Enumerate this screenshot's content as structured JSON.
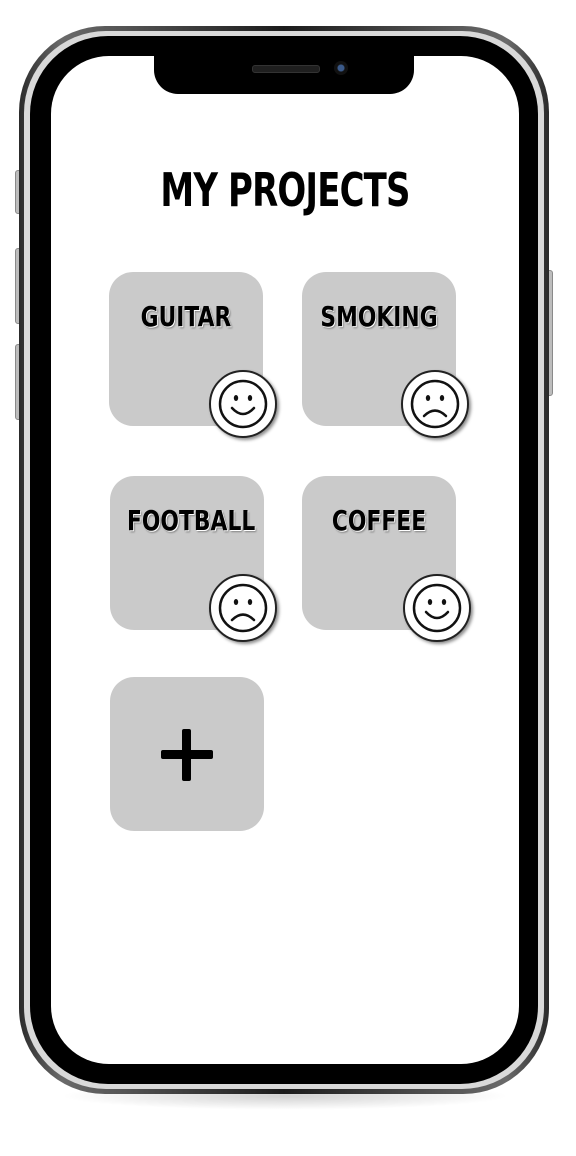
{
  "app": {
    "title": "MY PROJECTS"
  },
  "projects": [
    {
      "label": "GUITAR",
      "mood": "happy-face-icon"
    },
    {
      "label": "SMOKING",
      "mood": "sad-face-icon"
    },
    {
      "label": "FOOTBALL",
      "mood": "sad-face-icon"
    },
    {
      "label": "COFFEE",
      "mood": "happy-face-icon"
    }
  ],
  "add_button": {
    "icon": "plus-icon"
  },
  "colors": {
    "card": "#cacaca",
    "text": "#000000",
    "screen": "#ffffff"
  }
}
